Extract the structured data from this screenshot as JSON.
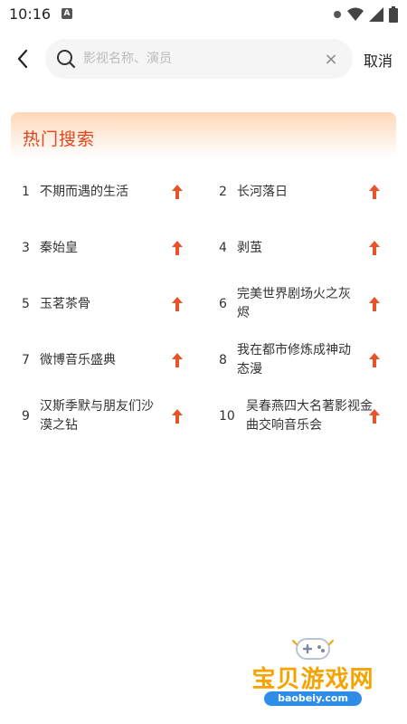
{
  "status_bar": {
    "time": "10:16",
    "indicator": "A",
    "icons": [
      "settings-dot-icon",
      "wifi-icon",
      "signal-icon",
      "battery-icon"
    ]
  },
  "search": {
    "placeholder": "影视名称、演员",
    "value": "",
    "clear_label": "×",
    "cancel_label": "取消"
  },
  "hot": {
    "title": "热门搜索",
    "accent_color": "#e0461e",
    "items": [
      {
        "rank": "1",
        "name": "不期而遇的生活"
      },
      {
        "rank": "2",
        "name": "长河落日"
      },
      {
        "rank": "3",
        "name": "秦始皇"
      },
      {
        "rank": "4",
        "name": "剥茧"
      },
      {
        "rank": "5",
        "name": "玉茗茶骨"
      },
      {
        "rank": "6",
        "name": "完美世界剧场火之灰烬"
      },
      {
        "rank": "7",
        "name": "微博音乐盛典"
      },
      {
        "rank": "8",
        "name": "我在都市修炼成神动态漫"
      },
      {
        "rank": "9",
        "name": "汉斯季默与朋友们沙漠之钻"
      },
      {
        "rank": "10",
        "name": "吴春燕四大名著影视金曲交响音乐会"
      }
    ]
  },
  "watermark": {
    "text": "宝贝游戏网",
    "url": "baobeiy.com"
  }
}
